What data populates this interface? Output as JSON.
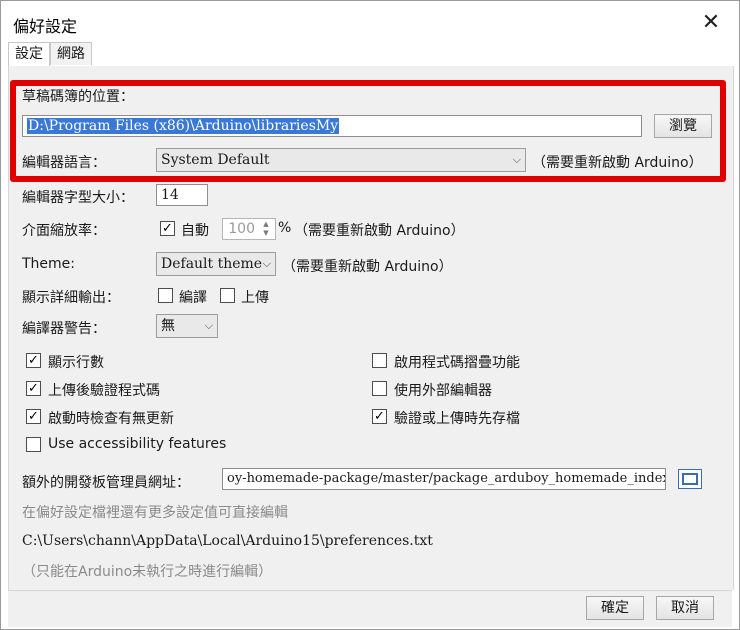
{
  "window": {
    "title": "偏好設定",
    "close_glyph": "✕"
  },
  "tabs": [
    {
      "label": "設定"
    },
    {
      "label": "網路"
    }
  ],
  "sketchbook": {
    "label": "草稿碼簿的位置：",
    "path": "D:\\Program Files (x86)\\Arduino\\librariesMy",
    "browse_label": "瀏覽"
  },
  "editor_language": {
    "label": "編輯器語言：",
    "value": "System Default",
    "note": "（需要重新啟動 Arduino）"
  },
  "font_size": {
    "label": "編輯器字型大小：",
    "value": "14"
  },
  "scaling": {
    "label": "介面縮放率：",
    "auto_label": "自動",
    "value": "100",
    "unit": "%",
    "note": "（需要重新啟動 Arduino）"
  },
  "theme": {
    "label": "Theme:",
    "value": "Default theme",
    "note": "（需要重新啟動 Arduino）"
  },
  "verbose": {
    "label": "顯示詳細輸出：",
    "compile_label": "編譯",
    "upload_label": "上傳"
  },
  "warnings": {
    "label": "編譯器警告：",
    "value": "無"
  },
  "options": {
    "show_line_numbers": "顯示行數",
    "verify_after_upload": "上傳後驗證程式碼",
    "check_updates": "啟動時檢查有無更新",
    "accessibility": "Use accessibility features",
    "code_folding": "啟用程式碼摺疊功能",
    "external_editor": "使用外部編輯器",
    "save_on_verify": "驗證或上傳時先存檔"
  },
  "board_manager": {
    "label": "額外的開發板管理員網址：",
    "url": "oy-homemade-package/master/package_arduboy_homemade_index.json"
  },
  "more_prefs_note": "在偏好設定檔裡還有更多設定值可直接編輯",
  "prefs_path": "C:\\Users\\chann\\AppData\\Local\\Arduino15\\preferences.txt",
  "edit_note": "（只能在Arduino未執行之時進行編輯）",
  "buttons": {
    "ok": "確定",
    "cancel": "取消"
  },
  "checkmark_glyph": "✓",
  "chevron_glyph": "⌵",
  "colors": {
    "highlight_border": "#e00000",
    "selection": "#3a78d6"
  }
}
